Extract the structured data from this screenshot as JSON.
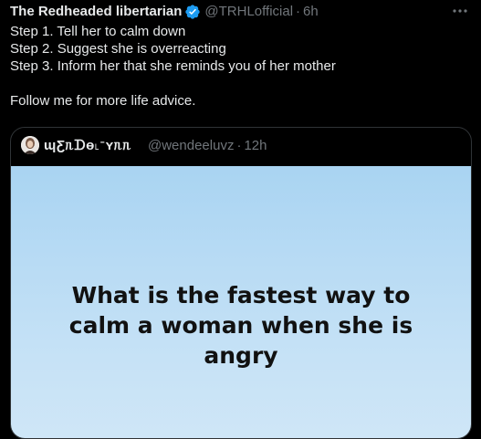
{
  "tweet": {
    "author": {
      "display_name": "The Redheaded libertarian",
      "handle": "@TRHLofficial",
      "verified_icon": "verified-badge-icon",
      "verified_color": "#1d9bf0"
    },
    "separator": "·",
    "time": "6h",
    "more_icon": "more-horizontal-icon",
    "lines": [
      "Step 1. Tell her to calm down",
      "Step 2. Suggest she is overreacting",
      "Step 3. Inform her that she reminds you of her mother",
      "",
      "Follow me for more life advice."
    ]
  },
  "quoted_tweet": {
    "author": {
      "display_name": "ɰƸᥰᗪɵ˪ᐨʏᥰᥰ",
      "handle": "@wendeeluvz",
      "avatar_icon": "avatar-icon"
    },
    "separator": "·",
    "time": "12h",
    "media": {
      "text_lines": [
        "What is the fastest way to",
        "calm a woman when she is",
        "angry"
      ],
      "background": "#b8dbf4"
    }
  }
}
